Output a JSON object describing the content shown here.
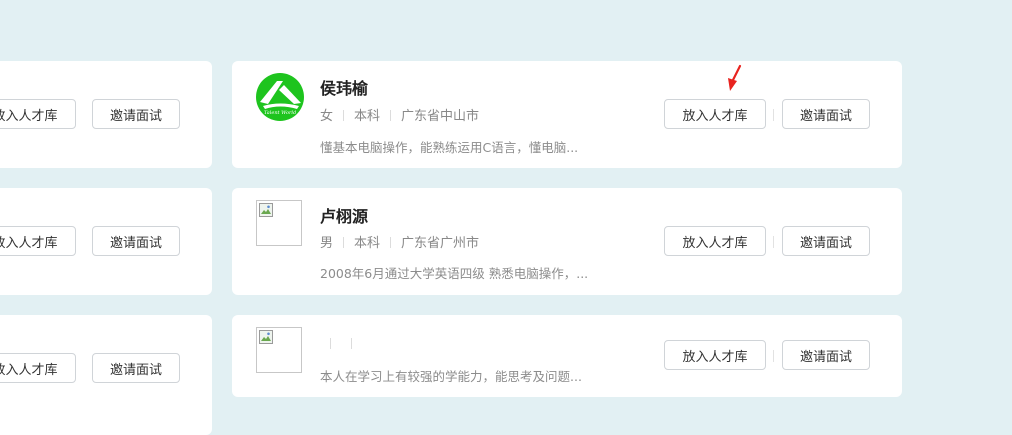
{
  "actions": {
    "talent_pool": "放入人才库",
    "invite": "邀请面试"
  },
  "candidates": [
    {
      "name": "侯玮榆",
      "gender": "女",
      "education": "本科",
      "location": "广东省中山市",
      "summary": "懂基本电脑操作，能熟练运用C语言，懂电脑...",
      "avatar": "green-logo-avatar"
    },
    {
      "name": "卢栩源",
      "gender": "男",
      "education": "本科",
      "location": "广东省广州市",
      "summary": "2008年6月通过大学英语四级 熟悉电脑操作，...",
      "avatar": "broken-image"
    },
    {
      "name": "",
      "gender": "",
      "education": "",
      "location": "",
      "summary": "本人在学习上有较强的学能力，能思考及问题...",
      "avatar": "broken-image"
    }
  ],
  "annotation": {
    "icon": "red-arrow-icon",
    "color": "#e8231f"
  },
  "colors": {
    "background": "#e2f0f3",
    "card": "#ffffff",
    "logo_green": "#1ec41e"
  }
}
